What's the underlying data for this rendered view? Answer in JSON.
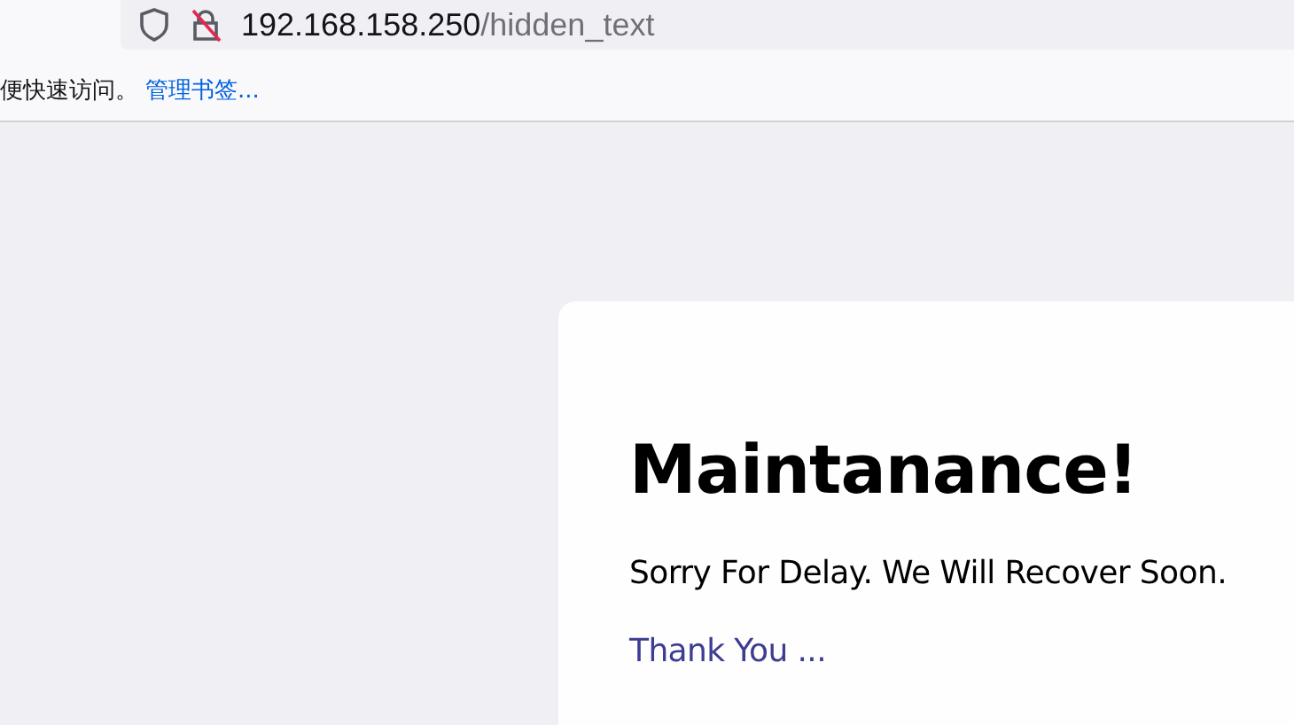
{
  "address_bar": {
    "host": "192.168.158.250",
    "path": "/hidden_text"
  },
  "bookmarks_bar": {
    "text": "便快速访问。",
    "link": "管理书签..."
  },
  "page": {
    "heading": "Maintanance!",
    "message": "Sorry For Delay. We Will Recover Soon.",
    "link": "Thank You ..."
  }
}
